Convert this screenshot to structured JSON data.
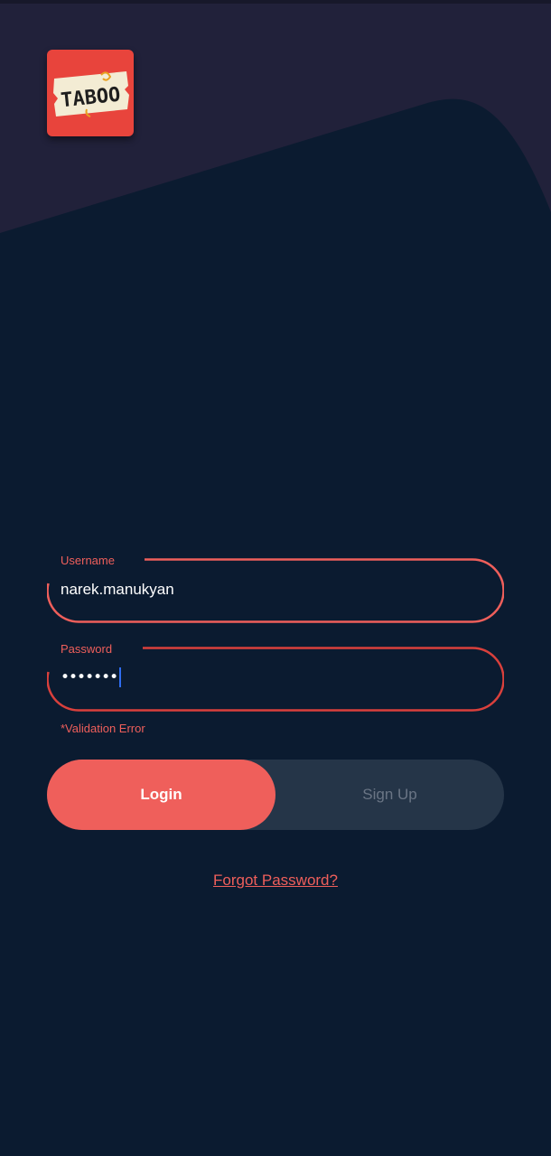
{
  "app": {
    "logo_text": "TABOO"
  },
  "colors": {
    "background": "#0b1b30",
    "top_panel": "#21213a",
    "accent": "#ef5f5b",
    "error": "#d9403c",
    "toggle_track": "#253548"
  },
  "form": {
    "username": {
      "label": "Username",
      "value": "narek.manukyan"
    },
    "password": {
      "label": "Password",
      "value": "•••••••"
    },
    "validation_message": "*Validation Error"
  },
  "auth_toggle": {
    "login_label": "Login",
    "signup_label": "Sign Up",
    "selected": "Login"
  },
  "links": {
    "forgot_password": "Forgot Password?"
  }
}
